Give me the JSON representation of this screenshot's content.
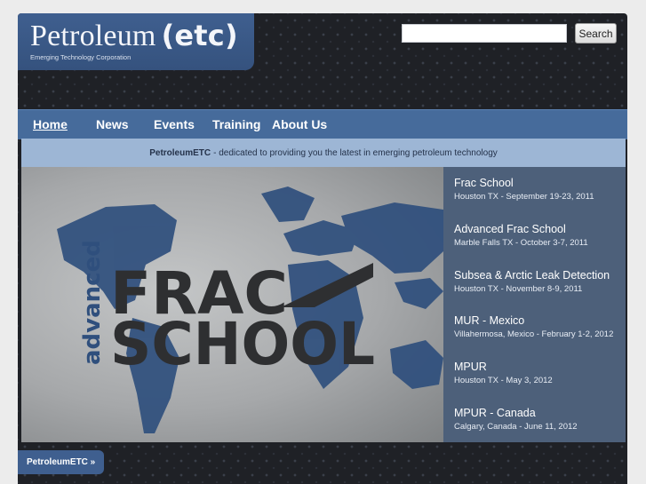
{
  "brand": {
    "name": "Petroleum",
    "name_suffix": "(etc)",
    "subtitle": "Emerging Technology Corporation"
  },
  "search": {
    "placeholder": "",
    "value": "",
    "button_label": "Search"
  },
  "nav": {
    "items": [
      {
        "label": "Home",
        "active": true
      },
      {
        "label": "News"
      },
      {
        "label": "Events"
      },
      {
        "label": "Training"
      },
      {
        "label": "About Us"
      }
    ]
  },
  "tagline": {
    "brand": "PetroleumETC",
    "text": "- dedicated to providing you the latest in emerging petroleum technology"
  },
  "hero": {
    "word_top": "FRAC",
    "word_bottom": "SCHOOL",
    "word_side": "advanced"
  },
  "events": [
    {
      "title": "Frac School",
      "detail": "Houston TX - September 19-23, 2011"
    },
    {
      "title": "Advanced Frac School",
      "detail": "Marble Falls TX - October 3-7, 2011"
    },
    {
      "title": "Subsea & Arctic Leak Detection",
      "detail": "Houston TX - November 8-9, 2011"
    },
    {
      "title": "MUR - Mexico",
      "detail": "Villahermosa, Mexico - February 1-2, 2012"
    },
    {
      "title": "MPUR",
      "detail": "Houston TX - May 3, 2012"
    },
    {
      "title": "MPUR - Canada",
      "detail": "Calgary, Canada - June 11, 2012"
    }
  ],
  "footer": {
    "tab_label": "PetroleumETC »"
  },
  "colors": {
    "frame_dark": "#1f2126",
    "brand_blue": "#3f5f8f",
    "nav_blue": "#466b9b",
    "tagline_bg": "#9db6d5",
    "map_blue": "#2f4f7d"
  }
}
